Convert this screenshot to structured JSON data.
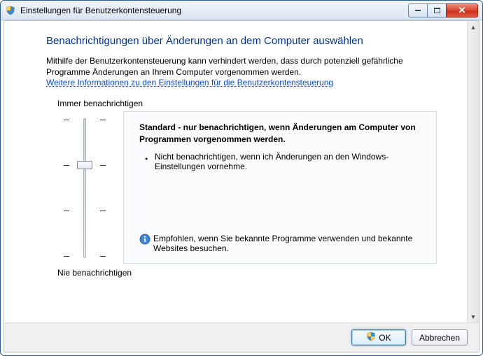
{
  "window": {
    "title": "Einstellungen für Benutzerkontensteuerung"
  },
  "page": {
    "heading": "Benachrichtigungen über Änderungen an dem Computer auswählen",
    "intro": "Mithilfe der Benutzerkontensteuerung kann verhindert werden, dass durch potenziell gefährliche Programme Änderungen an Ihrem Computer vorgenommen werden.",
    "help_link": "Weitere Informationen zu den Einstellungen für die Benutzerkontensteuerung"
  },
  "slider": {
    "top_label": "Immer benachrichtigen",
    "bottom_label": "Nie benachrichtigen",
    "levels": 4,
    "selected_index": 1
  },
  "description": {
    "title": "Standard - nur benachrichtigen, wenn Änderungen am Computer von Programmen vorgenommen werden.",
    "bullets": [
      "Nicht benachrichtigen, wenn ich Änderungen an den Windows-Einstellungen vornehme."
    ],
    "recommendation": "Empfohlen, wenn Sie bekannte Programme verwenden und bekannte Websites besuchen."
  },
  "buttons": {
    "ok": "OK",
    "cancel": "Abbrechen"
  }
}
